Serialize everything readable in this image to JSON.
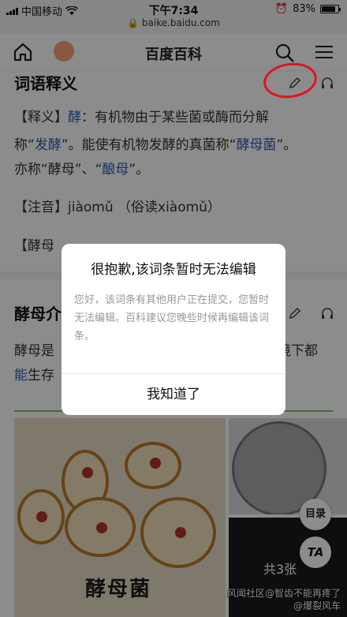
{
  "status_bar": {
    "carrier": "中国移动",
    "time": "下午7:34",
    "url": "baike.baidu.com",
    "battery": "83%"
  },
  "navbar": {
    "title": "百度百科"
  },
  "sections": {
    "meaning_title": "词语释义",
    "meaning_label": "【释义】",
    "meaning_word": "酵",
    "meaning_line1_rest": "：有机物由于某些菌或酶而分解",
    "meaning_line2_a": "称“",
    "meaning_line2_link1": "发酵",
    "meaning_line2_b": "”。能使有机物发酵的真菌称“",
    "meaning_line2_link2": "酵母菌",
    "meaning_line2_c": "”。",
    "meaning_line3_a": "亦称“酵母”、“",
    "meaning_line3_link": "酿母",
    "meaning_line3_b": "”。",
    "pinyin_label": "【注音】",
    "pinyin_value": "jiàomǔ （俗读xiàomǔ）",
    "partial_label": "【酵母",
    "intro_title": "酵母介",
    "intro_line1_a": "酵母是",
    "intro_line1_b": "境下都",
    "intro_line2_link": "能",
    "intro_line2_b": "生存"
  },
  "gallery": {
    "caption": "酵母菌",
    "count": "共3张"
  },
  "float_buttons": {
    "toc": "目录",
    "ta": "TA"
  },
  "watermark": {
    "line1": "风闻社区@智齿不能再疼了",
    "line2": "@爆裂风车"
  },
  "dialog": {
    "title": "很抱歉,该词条暂时无法编辑",
    "body": "您好，该词条有其他用户正在提交，您暂时无法编辑。百科建议您晚些时候再编辑该词条。",
    "confirm": "我知道了"
  },
  "colors": {
    "link": "#2b5fb6",
    "annotation_red": "#e2131d",
    "accent_green": "#7cc36b"
  }
}
